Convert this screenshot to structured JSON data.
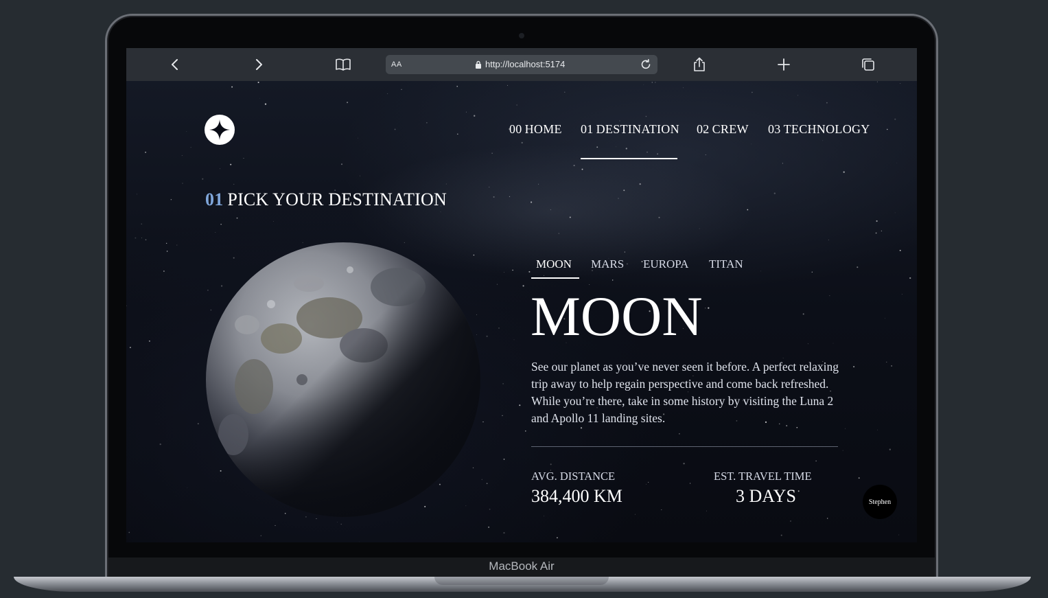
{
  "browser": {
    "text_size_label": "AA",
    "url": "http://localhost:5174"
  },
  "nav": {
    "items": [
      {
        "num": "00",
        "label": "HOME"
      },
      {
        "num": "01",
        "label": "DESTINATION"
      },
      {
        "num": "02",
        "label": "CREW"
      },
      {
        "num": "03",
        "label": "TECHNOLOGY"
      }
    ],
    "active": "DESTINATION"
  },
  "page": {
    "heading_num": "01",
    "heading_text": "PICK YOUR DESTINATION"
  },
  "tabs": {
    "items": [
      "MOON",
      "MARS",
      "EUROPA",
      "TITAN"
    ],
    "active": "MOON"
  },
  "destination": {
    "name": "MOON",
    "description": "See our planet as you’ve never seen it before. A perfect relaxing trip away to help regain perspective and come back refreshed. While you’re there, take in some history by visiting the Luna 2 and Apollo 11 landing sites.",
    "stats": {
      "distance_label": "AVG. DISTANCE",
      "distance_value": "384,400 KM",
      "time_label": "EST. TRAVEL TIME",
      "time_value": "3 DAYS"
    }
  },
  "user": {
    "name": "Stephen"
  },
  "device": {
    "label": "MacBook Air"
  },
  "colors": {
    "page_bg": "#0b0d14",
    "accent_number": "#7fa6da",
    "text": "#ffffff",
    "browser_bar": "#2b2f35",
    "frame": "#262c31"
  },
  "icons": {
    "logo": "star-logo-icon",
    "back": "chevron-left-icon",
    "forward": "chevron-right-icon",
    "bookmarks": "book-icon",
    "lock": "lock-icon",
    "reload": "reload-icon",
    "share": "share-icon",
    "new_tab": "plus-icon",
    "tabs": "tabs-overview-icon"
  }
}
